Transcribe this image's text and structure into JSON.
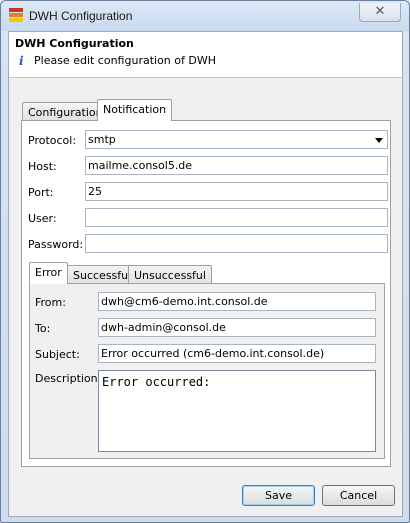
{
  "window": {
    "title": "DWH Configuration",
    "close_symbol": "✕"
  },
  "header": {
    "title": "DWH Configuration",
    "info_symbol": "i",
    "message": "Please edit configuration of DWH"
  },
  "main_tabs": [
    {
      "label": "Configuration",
      "active": false
    },
    {
      "label": "Notification",
      "active": true
    }
  ],
  "notification": {
    "protocol": {
      "label": "Protocol:",
      "value": "smtp"
    },
    "host": {
      "label": "Host:",
      "value": "mailme.consol5.de"
    },
    "port": {
      "label": "Port:",
      "value": "25"
    },
    "user": {
      "label": "User:",
      "value": ""
    },
    "password": {
      "label": "Password:",
      "value": ""
    }
  },
  "sub_tabs": [
    {
      "label": "Error",
      "active": true
    },
    {
      "label": "Successful",
      "active": false
    },
    {
      "label": "Unsuccessful",
      "active": false
    }
  ],
  "error_mail": {
    "from": {
      "label": "From:",
      "value": "dwh@cm6-demo.int.consol.de"
    },
    "to": {
      "label": "To:",
      "value": "dwh-admin@consol.de"
    },
    "subject": {
      "label": "Subject:",
      "value": "Error occurred (cm6-demo.int.consol.de)"
    },
    "description": {
      "label": "Description:",
      "value": "Error occurred:"
    }
  },
  "buttons": {
    "save": "Save",
    "cancel": "Cancel"
  },
  "colors": {
    "accent": "#3c7fb1",
    "info_icon": "#2a5db0"
  }
}
